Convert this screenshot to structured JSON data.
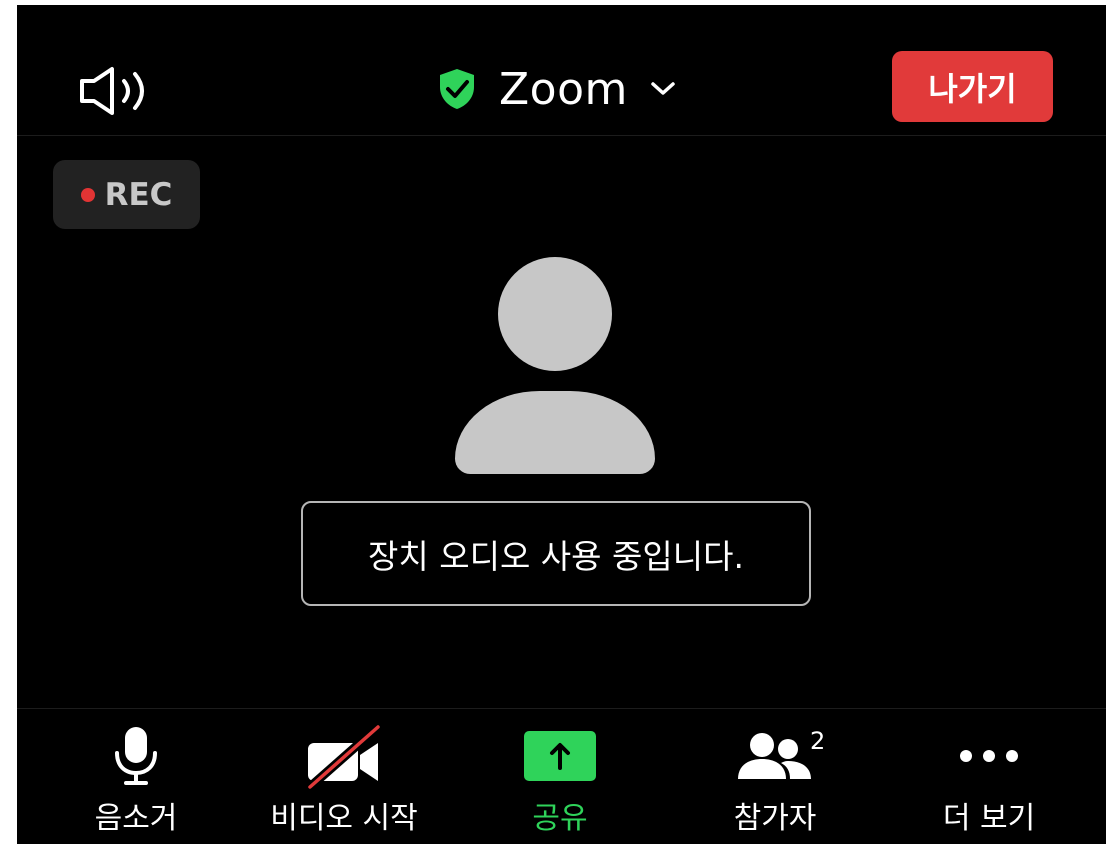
{
  "header": {
    "speaker_icon": "speaker-icon",
    "title": "Zoom",
    "shield_icon": "shield-check-icon",
    "shield_color": "#2fd35a",
    "chevron_icon": "chevron-down-icon",
    "leave_label": "나가기",
    "leave_color": "#e13a3a"
  },
  "recording": {
    "label": "REC",
    "dot_color": "#e23434"
  },
  "video": {
    "avatar_icon": "person-avatar-icon",
    "toast": "장치 오디오 사용 중입니다."
  },
  "toolbar": {
    "items": [
      {
        "label": "음소거",
        "icon": "microphone-icon"
      },
      {
        "label": "비디오 시작",
        "icon": "video-off-icon"
      },
      {
        "label": "공유",
        "icon": "share-arrow-up-icon",
        "accent": "#2fd35a"
      },
      {
        "label": "참가자",
        "icon": "participants-icon",
        "count": "2"
      },
      {
        "label": "더 보기",
        "icon": "more-dots-icon"
      }
    ]
  }
}
